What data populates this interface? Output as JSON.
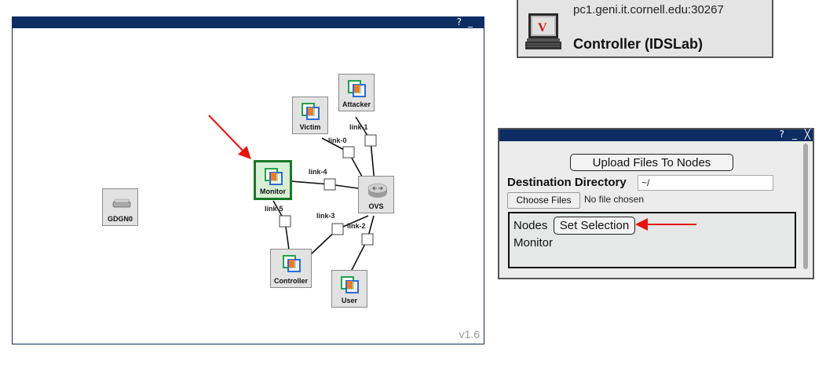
{
  "topology": {
    "help_glyph": "?",
    "minimize_glyph": "_",
    "version": "v1.6",
    "nodes": [
      {
        "id": "attacker",
        "label": "Attacker",
        "icon": "vm-icon"
      },
      {
        "id": "victim",
        "label": "Victim",
        "icon": "vm-icon"
      },
      {
        "id": "monitor",
        "label": "Monitor",
        "icon": "vm-icon",
        "selected": true
      },
      {
        "id": "ovs",
        "label": "OVS",
        "icon": "switch-icon"
      },
      {
        "id": "controller",
        "label": "Controller",
        "icon": "vm-icon"
      },
      {
        "id": "user",
        "label": "User",
        "icon": "vm-icon"
      },
      {
        "id": "gdgn0",
        "label": "GDGN0",
        "icon": "gateway-icon"
      }
    ],
    "links": [
      "link-0",
      "link-1",
      "link-2",
      "link-3",
      "link-4",
      "link-5"
    ]
  },
  "controller_tile": {
    "host": "pc1.geni.it.cornell.edu:30267",
    "name": "Controller (IDSLab)",
    "icon": "terminal-icon"
  },
  "upload": {
    "help_glyph": "?",
    "minimize_glyph": "_",
    "close_glyph": "╳",
    "upload_button": "Upload Files To Nodes",
    "dest_label": "Destination Directory",
    "dest_value": "~/",
    "choose_button": "Choose Files",
    "no_file": "No file chosen",
    "nodes_label": "Nodes",
    "set_selection": "Set Selection",
    "selected_node": "Monitor"
  },
  "colors": {
    "titlebar": "#0d2d63",
    "selected_border": "#187a23",
    "arrow": "#e8130f",
    "vm_green": "#21a24c",
    "vm_blue": "#2b6bd6",
    "vm_orange": "#f07a2a"
  }
}
